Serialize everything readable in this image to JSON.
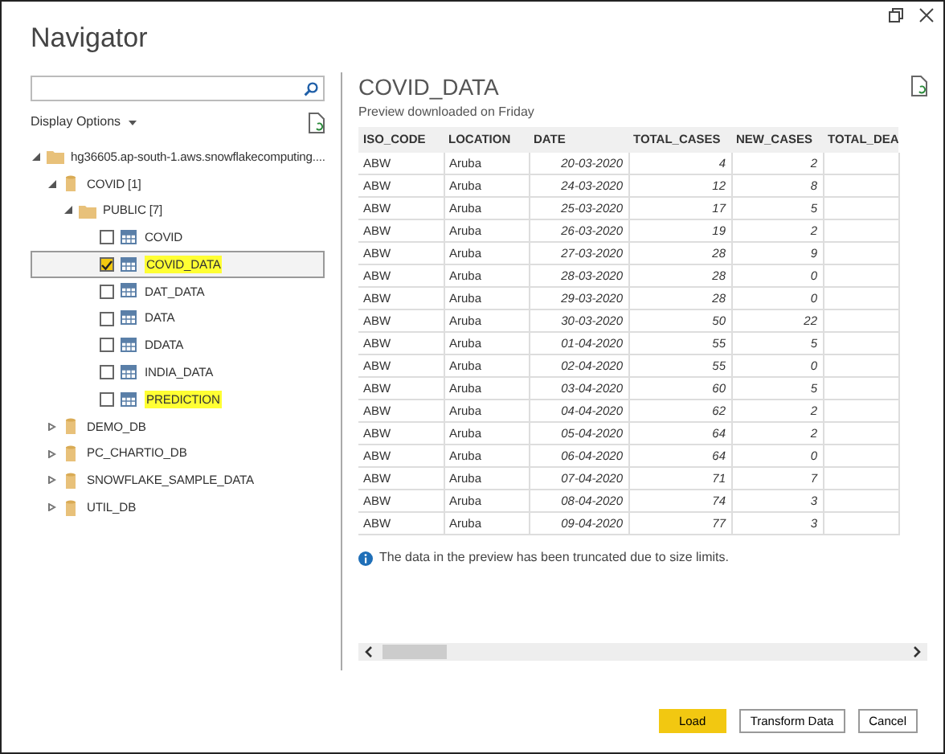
{
  "window": {
    "title": "Navigator"
  },
  "display_options": "Display Options",
  "tree": [
    {
      "kind": "server",
      "label": "hg36605.ap-south-1.aws.snowflakecomputing....",
      "expanded": true,
      "children": [
        {
          "kind": "database",
          "label": "COVID [1]",
          "expanded": true,
          "children": [
            {
              "kind": "folder",
              "label": "PUBLIC [7]",
              "expanded": true,
              "children": [
                {
                  "kind": "table",
                  "label": "COVID",
                  "checked": false,
                  "selected": false,
                  "highlighted": false
                },
                {
                  "kind": "table",
                  "label": "COVID_DATA",
                  "checked": true,
                  "selected": true,
                  "highlighted": true
                },
                {
                  "kind": "table",
                  "label": "DAT_DATA",
                  "checked": false,
                  "selected": false,
                  "highlighted": false
                },
                {
                  "kind": "table",
                  "label": "DATA",
                  "checked": false,
                  "selected": false,
                  "highlighted": false
                },
                {
                  "kind": "table",
                  "label": "DDATA",
                  "checked": false,
                  "selected": false,
                  "highlighted": false
                },
                {
                  "kind": "table",
                  "label": "INDIA_DATA",
                  "checked": false,
                  "selected": false,
                  "highlighted": false
                },
                {
                  "kind": "table",
                  "label": "PREDICTION",
                  "checked": false,
                  "selected": false,
                  "highlighted": true
                }
              ]
            }
          ]
        },
        {
          "kind": "database",
          "label": "DEMO_DB",
          "expanded": false
        },
        {
          "kind": "database",
          "label": "PC_CHARTIO_DB",
          "expanded": false
        },
        {
          "kind": "database",
          "label": "SNOWFLAKE_SAMPLE_DATA",
          "expanded": false
        },
        {
          "kind": "database",
          "label": "UTIL_DB",
          "expanded": false
        }
      ]
    }
  ],
  "preview": {
    "title": "COVID_DATA",
    "subtitle": "Preview downloaded on Friday",
    "columns": [
      "ISO_CODE",
      "LOCATION",
      "DATE",
      "TOTAL_CASES",
      "NEW_CASES",
      "TOTAL_DEA"
    ],
    "rows": [
      [
        "ABW",
        "Aruba",
        "20-03-2020",
        "4",
        "2"
      ],
      [
        "ABW",
        "Aruba",
        "24-03-2020",
        "12",
        "8"
      ],
      [
        "ABW",
        "Aruba",
        "25-03-2020",
        "17",
        "5"
      ],
      [
        "ABW",
        "Aruba",
        "26-03-2020",
        "19",
        "2"
      ],
      [
        "ABW",
        "Aruba",
        "27-03-2020",
        "28",
        "9"
      ],
      [
        "ABW",
        "Aruba",
        "28-03-2020",
        "28",
        "0"
      ],
      [
        "ABW",
        "Aruba",
        "29-03-2020",
        "28",
        "0"
      ],
      [
        "ABW",
        "Aruba",
        "30-03-2020",
        "50",
        "22"
      ],
      [
        "ABW",
        "Aruba",
        "01-04-2020",
        "55",
        "5"
      ],
      [
        "ABW",
        "Aruba",
        "02-04-2020",
        "55",
        "0"
      ],
      [
        "ABW",
        "Aruba",
        "03-04-2020",
        "60",
        "5"
      ],
      [
        "ABW",
        "Aruba",
        "04-04-2020",
        "62",
        "2"
      ],
      [
        "ABW",
        "Aruba",
        "05-04-2020",
        "64",
        "2"
      ],
      [
        "ABW",
        "Aruba",
        "06-04-2020",
        "64",
        "0"
      ],
      [
        "ABW",
        "Aruba",
        "07-04-2020",
        "71",
        "7"
      ],
      [
        "ABW",
        "Aruba",
        "08-04-2020",
        "74",
        "3"
      ],
      [
        "ABW",
        "Aruba",
        "09-04-2020",
        "77",
        "3"
      ]
    ],
    "notice": "The data in the preview has been truncated due to size limits."
  },
  "buttons": [
    {
      "label": "Load",
      "kind": "primary"
    },
    {
      "label": "Transform Data",
      "kind": "secondary"
    },
    {
      "label": "Cancel",
      "kind": "secondary"
    }
  ]
}
